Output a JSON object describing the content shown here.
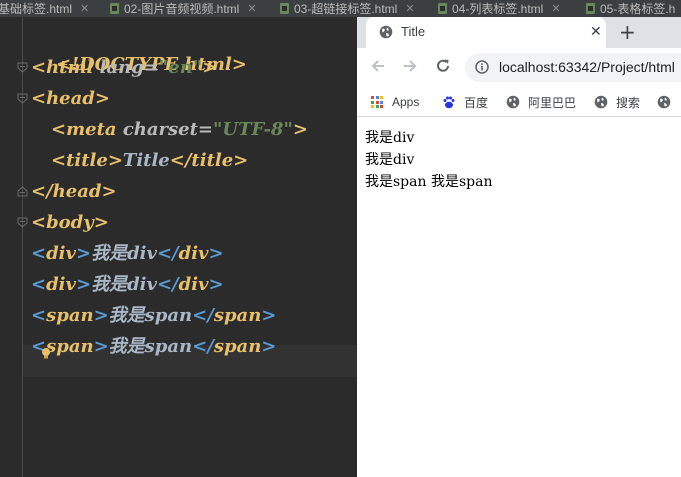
{
  "ide": {
    "tabs": [
      {
        "label": "基础标签.html"
      },
      {
        "label": "02-图片音频视频.html"
      },
      {
        "label": "03-超链接标签.html"
      },
      {
        "label": "04-列表标签.html"
      },
      {
        "label": "05-表格标签.h"
      }
    ],
    "code": {
      "l1_doctype": "<!DOCTYPE html>",
      "l2_open": "<html",
      "l2_attr": " lang=",
      "l2_val": "\"en\"",
      "l2_close": ">",
      "l3": "<head>",
      "l4_open": "<meta",
      "l4_attr": " charset=",
      "l4_val": "\"UTF-8\"",
      "l4_close": ">",
      "l5_open": "<title>",
      "l5_text": "Title",
      "l5_close": "</title>",
      "l6": "</head>",
      "l7": "<body>",
      "div_open_lt": "<",
      "div_name": "div",
      "gt": ">",
      "div_text": "我是div",
      "div_close_lt": "</",
      "span_name": "span",
      "span_text": "我是span"
    }
  },
  "browser": {
    "tab_title": "Title",
    "tab_close": "✕",
    "new_tab": "+",
    "url": "localhost:63342/Project/html",
    "bookmarks": [
      {
        "label": "Apps"
      },
      {
        "label": "百度"
      },
      {
        "label": "阿里巴巴"
      },
      {
        "label": "搜索"
      }
    ],
    "content": {
      "line1": "我是div",
      "line2": "我是div",
      "span1": "我是span",
      "span2": "我是span"
    }
  },
  "colors": {
    "tag": "#e8bf6a",
    "string": "#6a8759",
    "editor_bg": "#2b2b2b",
    "chrome_tabstrip": "#dee1e6"
  }
}
